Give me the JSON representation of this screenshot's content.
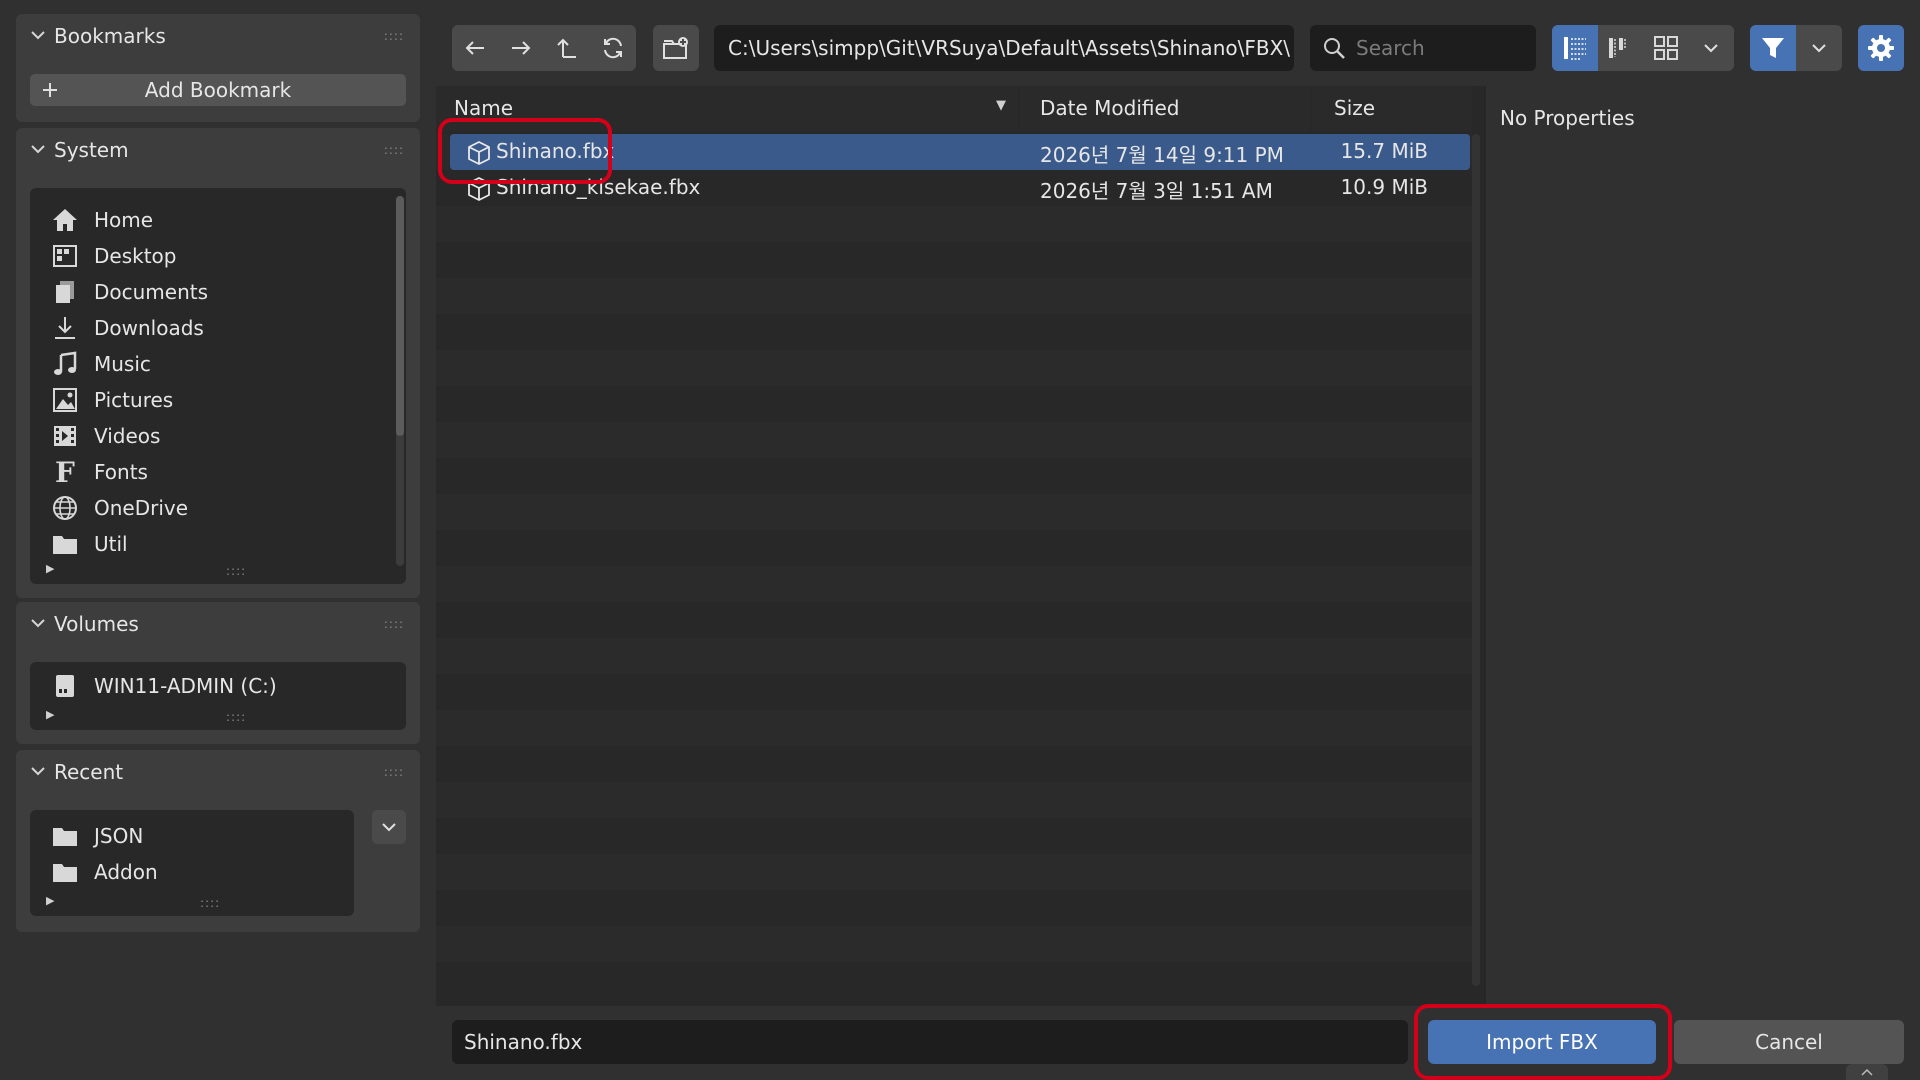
{
  "sidebar": {
    "bookmarks": {
      "title": "Bookmarks",
      "add_label": "Add Bookmark"
    },
    "system": {
      "title": "System",
      "items": [
        {
          "label": "Home",
          "icon": "home-icon"
        },
        {
          "label": "Desktop",
          "icon": "desktop-icon"
        },
        {
          "label": "Documents",
          "icon": "documents-icon"
        },
        {
          "label": "Downloads",
          "icon": "downloads-icon"
        },
        {
          "label": "Music",
          "icon": "music-icon"
        },
        {
          "label": "Pictures",
          "icon": "pictures-icon"
        },
        {
          "label": "Videos",
          "icon": "videos-icon"
        },
        {
          "label": "Fonts",
          "icon": "fonts-icon"
        },
        {
          "label": "OneDrive",
          "icon": "globe-icon"
        },
        {
          "label": "Util",
          "icon": "folder-icon"
        }
      ]
    },
    "volumes": {
      "title": "Volumes",
      "items": [
        {
          "label": "WIN11-ADMIN (C:)",
          "icon": "drive-icon"
        }
      ]
    },
    "recent": {
      "title": "Recent",
      "items": [
        {
          "label": "JSON",
          "icon": "folder-icon"
        },
        {
          "label": "Addon",
          "icon": "folder-icon"
        }
      ]
    }
  },
  "toolbar": {
    "path": "C:\\Users\\simpp\\Git\\VRSuya\\Default\\Assets\\Shinano\\FBX\\",
    "search_placeholder": "Search"
  },
  "file_list": {
    "columns": {
      "name": "Name",
      "date": "Date Modified",
      "size": "Size"
    },
    "files": [
      {
        "name": "Shinano.fbx",
        "date": "2026년 7월 14일 9:11 PM",
        "size": "15.7 MiB",
        "selected": true
      },
      {
        "name": "Shinano_kisekae.fbx",
        "date": "2026년 7월 3일 1:51 AM",
        "size": "10.9 MiB",
        "selected": false
      }
    ]
  },
  "properties": {
    "empty_label": "No Properties"
  },
  "footer": {
    "filename": "Shinano.fbx",
    "import_label": "Import FBX",
    "cancel_label": "Cancel"
  },
  "colors": {
    "accent": "#4772b3",
    "selection": "#3b5a8c",
    "highlight": "#d4001a"
  }
}
